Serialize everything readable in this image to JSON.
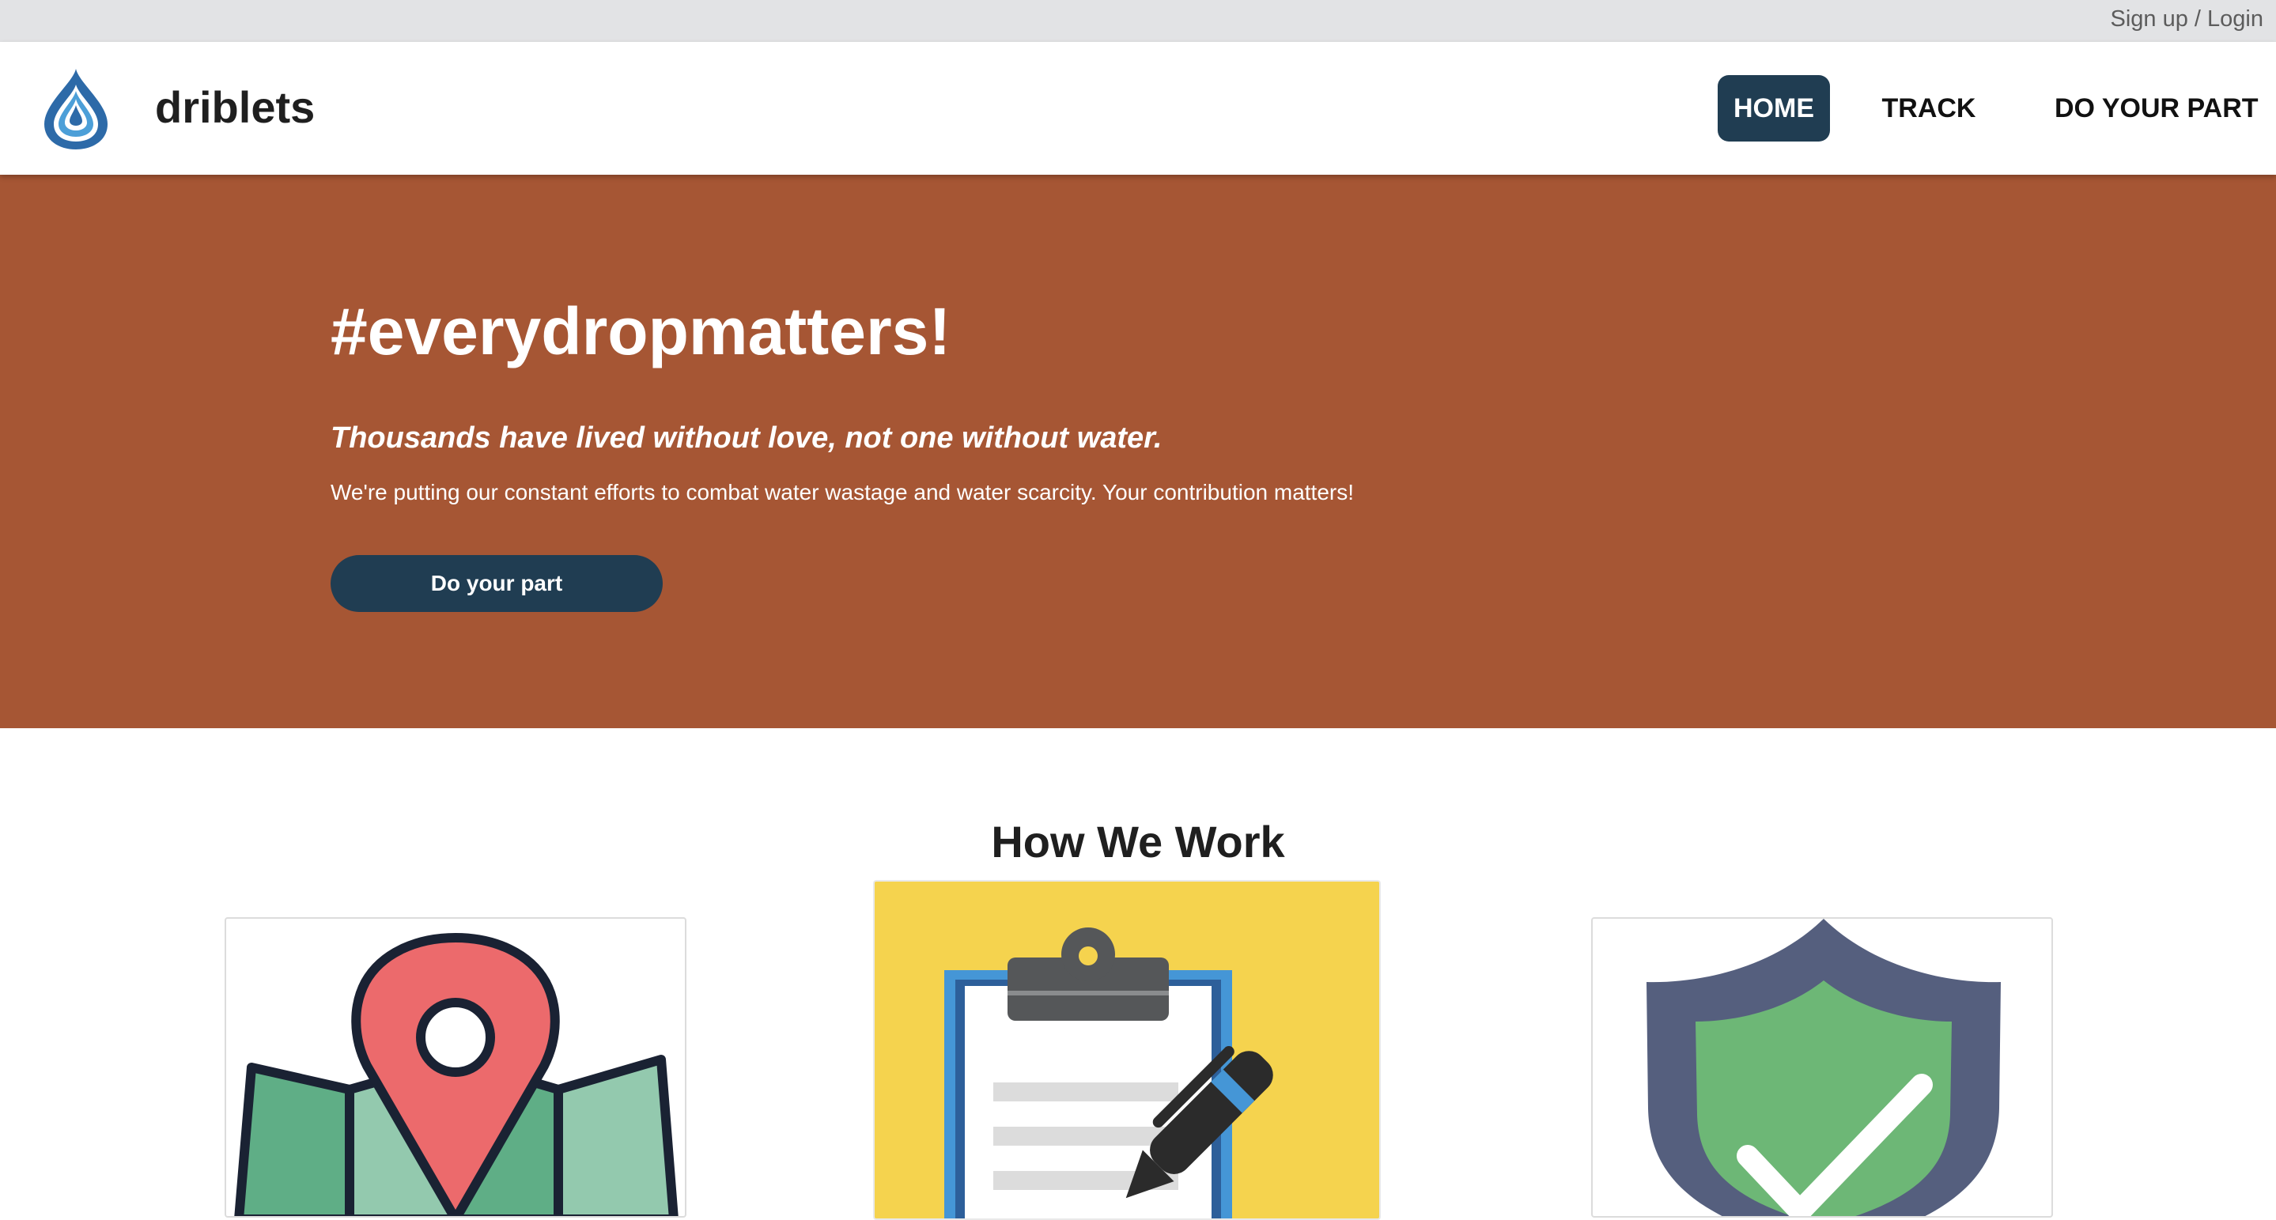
{
  "topbar": {
    "auth_link": "Sign up / Login"
  },
  "header": {
    "brand": "driblets",
    "logo_icon": "water-drop-icon",
    "nav": [
      {
        "label": "HOME",
        "active": true
      },
      {
        "label": "TRACK",
        "active": false
      },
      {
        "label": "DO YOUR PART",
        "active": false
      }
    ]
  },
  "hero": {
    "title": "#everydropmatters!",
    "quote": "Thousands have lived without love, not one without water.",
    "description": "We're putting our constant efforts to combat water wastage and water scarcity. Your contribution matters!",
    "cta_label": "Do your part"
  },
  "how_we_work": {
    "title": "How We Work",
    "cards": [
      {
        "icon": "map-pin-icon"
      },
      {
        "icon": "clipboard-icon"
      },
      {
        "icon": "shield-check-icon"
      }
    ]
  },
  "colors": {
    "hero_background": "#a65634",
    "accent_dark": "#203d52",
    "topbar": "#e2e3e5"
  }
}
